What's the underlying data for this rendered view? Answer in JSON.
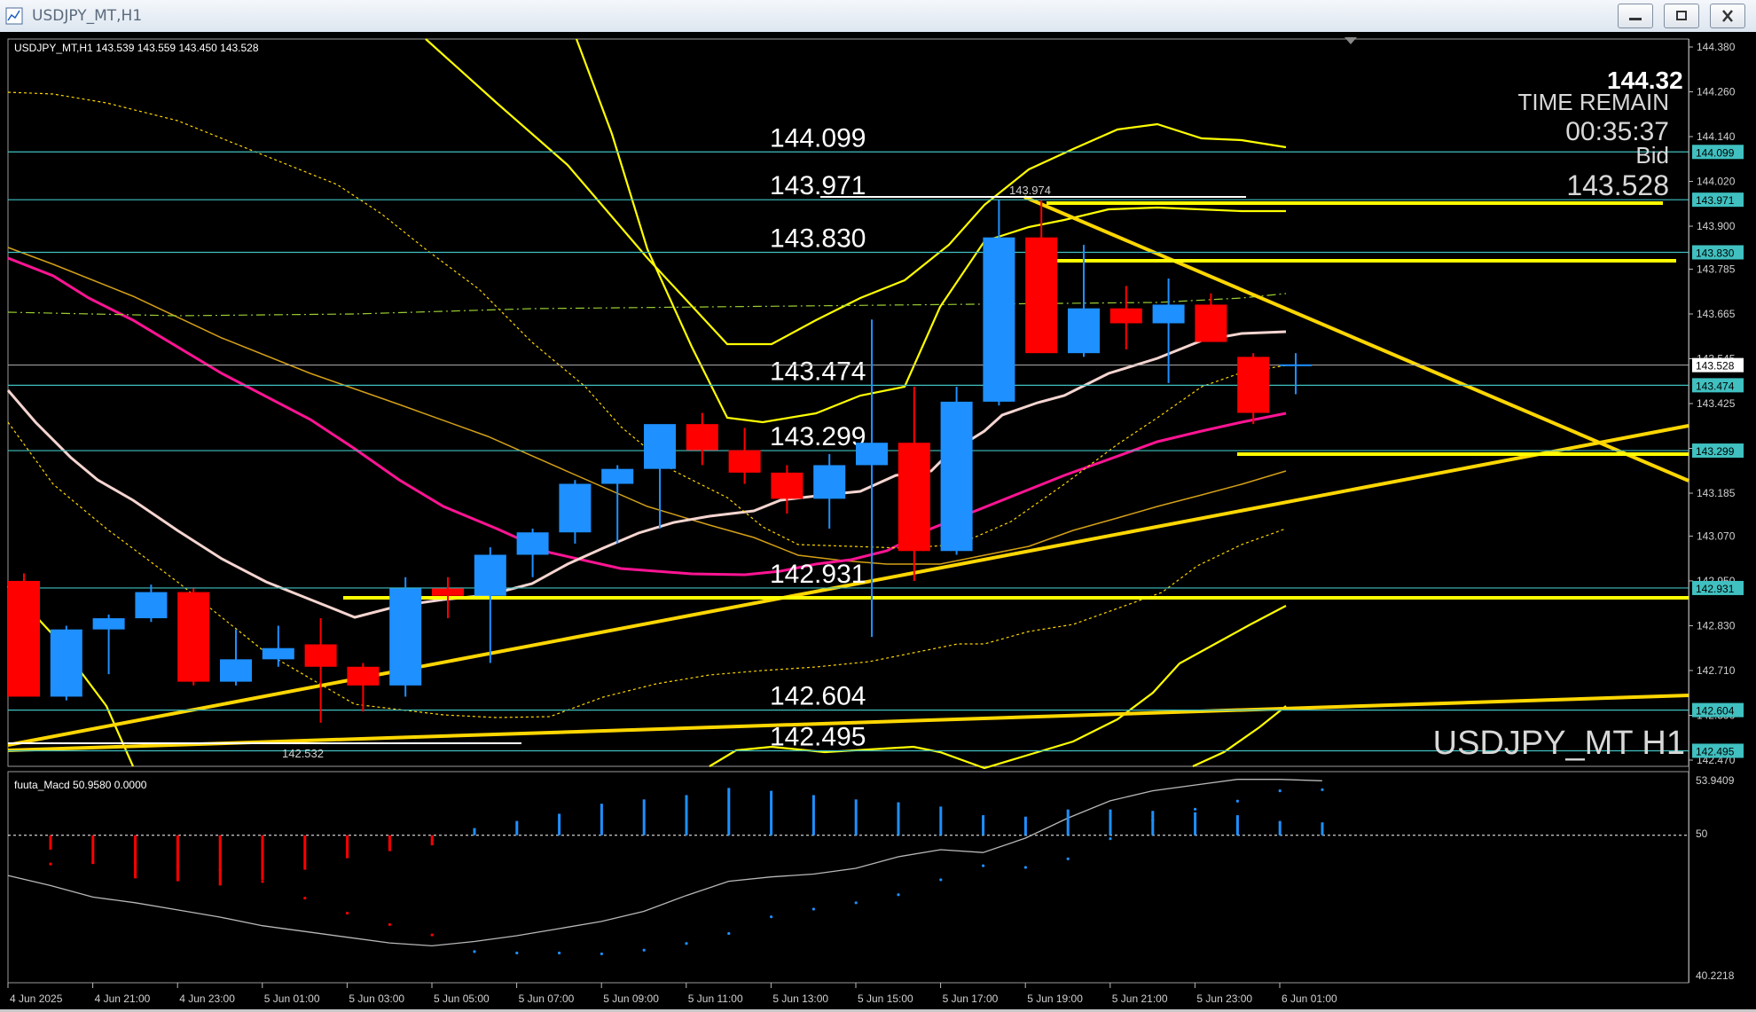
{
  "window": {
    "title": "USDJPY_MT,H1"
  },
  "chart": {
    "info_line": "USDJPY_MT,H1  143.539 143.559 143.450 143.528",
    "symbol_watermark": "USDJPY_MT H1",
    "price_big": "144.32",
    "time_remain_label": "TIME REMAIN",
    "time_remain_value": "00:35:37",
    "bid_label": "Bid",
    "bid_value": "143.528",
    "high_marker": "143.974",
    "low_marker": "142.532",
    "price_axis": [
      "144.380",
      "144.260",
      "144.140",
      "144.020",
      "143.900",
      "143.785",
      "143.665",
      "143.545",
      "143.425",
      "143.305",
      "143.185",
      "143.070",
      "142.950",
      "142.830",
      "142.710",
      "142.590",
      "142.470"
    ],
    "axis_badges": [
      {
        "label": "144.099",
        "kind": "level"
      },
      {
        "label": "143.971",
        "kind": "level"
      },
      {
        "label": "143.830",
        "kind": "level"
      },
      {
        "label": "143.528",
        "kind": "bid"
      },
      {
        "label": "143.474",
        "kind": "level"
      },
      {
        "label": "143.299",
        "kind": "level"
      },
      {
        "label": "142.931",
        "kind": "level"
      },
      {
        "label": "142.604",
        "kind": "level"
      },
      {
        "label": "142.495",
        "kind": "level"
      }
    ],
    "levels": [
      {
        "price": 144.099,
        "label": "144.099"
      },
      {
        "price": 143.971,
        "label": "143.971"
      },
      {
        "price": 143.83,
        "label": "143.830"
      },
      {
        "price": 143.474,
        "label": "143.474"
      },
      {
        "price": 143.299,
        "label": "143.299"
      },
      {
        "price": 142.931,
        "label": "142.931"
      },
      {
        "price": 142.604,
        "label": "142.604"
      },
      {
        "price": 142.495,
        "label": "142.495"
      }
    ],
    "time_axis": [
      "4 Jun 2025",
      "4 Jun 21:00",
      "4 Jun 23:00",
      "5 Jun 01:00",
      "5 Jun 03:00",
      "5 Jun 05:00",
      "5 Jun 07:00",
      "5 Jun 09:00",
      "5 Jun 11:00",
      "5 Jun 13:00",
      "5 Jun 15:00",
      "5 Jun 17:00",
      "5 Jun 19:00",
      "5 Jun 21:00",
      "5 Jun 23:00",
      "6 Jun 01:00"
    ]
  },
  "macd": {
    "info_line": "fuuta_Macd 50.9580  0.0000",
    "axis_top": "53.9409",
    "axis_mid": "50",
    "axis_bottom": "40.2218"
  },
  "colors": {
    "background": "#000000",
    "bull": "#1e90ff",
    "bear": "#ff0000",
    "level_line": "#40c0c0",
    "trendline": "#ffd700",
    "bollinger": "#ffff00",
    "ma_pink": "#ff1493",
    "ma_white": "#ffe4e1"
  },
  "chart_data": {
    "type": "candlestick",
    "symbol": "USDJPY_MT",
    "timeframe": "H1",
    "candles": [
      {
        "o": 142.95,
        "h": 142.97,
        "l": 142.64,
        "c": 142.64
      },
      {
        "o": 142.64,
        "h": 142.83,
        "l": 142.63,
        "c": 142.82
      },
      {
        "o": 142.82,
        "h": 142.86,
        "l": 142.7,
        "c": 142.85
      },
      {
        "o": 142.85,
        "h": 142.94,
        "l": 142.84,
        "c": 142.92
      },
      {
        "o": 142.92,
        "h": 142.93,
        "l": 142.67,
        "c": 142.68
      },
      {
        "o": 142.68,
        "h": 142.82,
        "l": 142.67,
        "c": 142.74
      },
      {
        "o": 142.74,
        "h": 142.83,
        "l": 142.72,
        "c": 142.77
      },
      {
        "o": 142.78,
        "h": 142.85,
        "l": 142.57,
        "c": 142.72
      },
      {
        "o": 142.72,
        "h": 142.73,
        "l": 142.6,
        "c": 142.67
      },
      {
        "o": 142.67,
        "h": 142.96,
        "l": 142.64,
        "c": 142.93
      },
      {
        "o": 142.93,
        "h": 142.96,
        "l": 142.85,
        "c": 142.91
      },
      {
        "o": 142.91,
        "h": 143.04,
        "l": 142.73,
        "c": 143.02
      },
      {
        "o": 143.02,
        "h": 143.09,
        "l": 142.96,
        "c": 143.08
      },
      {
        "o": 143.08,
        "h": 143.22,
        "l": 143.05,
        "c": 143.21
      },
      {
        "o": 143.21,
        "h": 143.26,
        "l": 143.05,
        "c": 143.25
      },
      {
        "o": 143.25,
        "h": 143.35,
        "l": 143.09,
        "c": 143.37
      },
      {
        "o": 143.37,
        "h": 143.4,
        "l": 143.26,
        "c": 143.3
      },
      {
        "o": 143.3,
        "h": 143.36,
        "l": 143.21,
        "c": 143.24
      },
      {
        "o": 143.24,
        "h": 143.26,
        "l": 143.13,
        "c": 143.17
      },
      {
        "o": 143.17,
        "h": 143.29,
        "l": 143.09,
        "c": 143.26
      },
      {
        "o": 143.26,
        "h": 143.65,
        "l": 142.8,
        "c": 143.32
      },
      {
        "o": 143.32,
        "h": 143.47,
        "l": 142.95,
        "c": 143.03
      },
      {
        "o": 143.03,
        "h": 143.47,
        "l": 143.02,
        "c": 143.43
      },
      {
        "o": 143.43,
        "h": 143.97,
        "l": 143.42,
        "c": 143.87
      },
      {
        "o": 143.87,
        "h": 143.97,
        "l": 143.56,
        "c": 143.56
      },
      {
        "o": 143.56,
        "h": 143.85,
        "l": 143.55,
        "c": 143.68
      },
      {
        "o": 143.68,
        "h": 143.74,
        "l": 143.57,
        "c": 143.64
      },
      {
        "o": 143.64,
        "h": 143.76,
        "l": 143.48,
        "c": 143.69
      },
      {
        "o": 143.69,
        "h": 143.72,
        "l": 143.59,
        "c": 143.59
      },
      {
        "o": 143.55,
        "h": 143.56,
        "l": 143.37,
        "c": 143.4
      },
      {
        "o": 143.53,
        "h": 143.56,
        "l": 143.45,
        "c": 143.53
      }
    ],
    "horizontal_levels": [
      144.099,
      143.971,
      143.83,
      143.474,
      143.299,
      142.931,
      142.604,
      142.495
    ],
    "last_bid": 143.528,
    "y_range": [
      142.47,
      144.4
    ],
    "macd": {
      "signal_line": [
        47.2,
        46.5,
        45.7,
        45.3,
        44.8,
        44.3,
        43.7,
        43.3,
        42.9,
        42.5,
        42.3,
        42.6,
        43.0,
        43.5,
        44.0,
        44.7,
        45.8,
        46.8,
        47.1,
        47.3,
        47.7,
        48.5,
        49.0,
        48.8,
        49.8,
        51.2,
        52.4,
        53.1,
        53.5,
        53.9,
        53.9,
        53.8
      ],
      "histogram": [
        49.0,
        48.0,
        47.0,
        46.8,
        46.5,
        46.9,
        47.6,
        48.4,
        48.9,
        49.3,
        50.5,
        51.0,
        51.5,
        52.2,
        52.5,
        52.8,
        53.3,
        53.1,
        52.8,
        52.5,
        52.3,
        52.0,
        51.4,
        51.3,
        51.8,
        51.8,
        51.7,
        51.6,
        51.4,
        51.0,
        50.9
      ],
      "axis_top": 53.9409,
      "axis_bottom": 40.2218,
      "zero_level": 50
    }
  }
}
